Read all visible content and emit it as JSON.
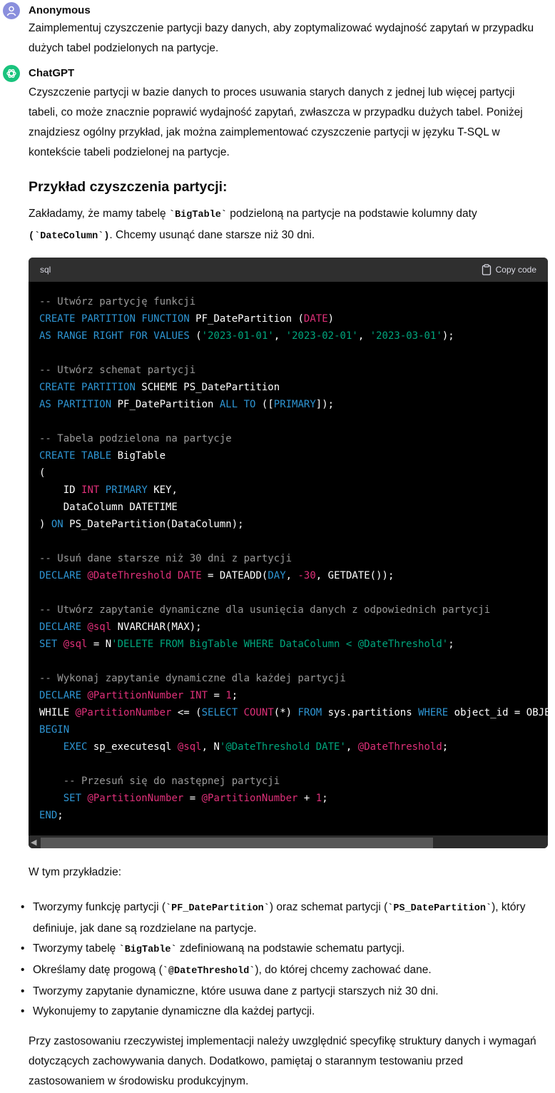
{
  "user": {
    "name": "Anonymous",
    "message": "Zaimplementuj czyszczenie partycji bazy danych, aby zoptymalizować wydajność zapytań w przypadku dużych tabel podzielonych na partycje."
  },
  "assistant": {
    "name": "ChatGPT",
    "intro": "Czyszczenie partycji w bazie danych to proces usuwania starych danych z jednej lub więcej partycji tabeli, co może znacznie poprawić wydajność zapytań, zwłaszcza w przypadku dużych tabel. Poniżej znajdziesz ogólny przykład, jak można zaimplementować czyszczenie partycji w języku T-SQL w kontekście tabeli podzielonej na partycje.",
    "heading": "Przykład czyszczenia partycji:",
    "assume": {
      "p1": "Zakładamy, że mamy tabelę ",
      "code1": "`BigTable`",
      "p2": " podzieloną na partycje na podstawie kolumny daty",
      "code2": "(`DateColumn`)",
      "p3": ". Chcemy usunąć dane starsze niż 30 dni."
    },
    "code_block": {
      "language": "sql",
      "copy_label": "Copy code"
    },
    "in_example": "W tym przykładzie:",
    "bullets": {
      "b1_a": "Tworzymy funkcję partycji (",
      "b1_code1": "`PF_DatePartition`",
      "b1_b": ") oraz schemat partycji (",
      "b1_code2": "`PS_DatePartition`",
      "b1_c": "), który definiuje, jak dane są rozdzielane na partycje.",
      "b2_a": "Tworzymy tabelę ",
      "b2_code": "`BigTable`",
      "b2_b": " zdefiniowaną na podstawie schematu partycji.",
      "b3_a": "Określamy datę progową (",
      "b3_code": "`@DateThreshold`",
      "b3_b": "), do której chcemy zachować dane.",
      "b4": "Tworzymy zapytanie dynamiczne, które usuwa dane z partycji starszych niż 30 dni.",
      "b5": "Wykonujemy to zapytanie dynamiczne dla każdej partycji."
    },
    "closing": "Przy zastosowaniu rzeczywistej implementacji należy uwzględnić specyfikę struktury danych i wymagań dotyczących zachowywania danych. Dodatkowo, pamiętaj o starannym testowaniu przed zastosowaniem w środowisku produkcyjnym."
  },
  "code_lines": [
    [
      [
        "c",
        "-- Utwórz partycję funkcji"
      ]
    ],
    [
      [
        "k",
        "CREATE"
      ],
      [
        "p",
        " "
      ],
      [
        "k",
        "PARTITION"
      ],
      [
        "p",
        " "
      ],
      [
        "k",
        "FUNCTION"
      ],
      [
        "p",
        " PF_DatePartition ("
      ],
      [
        "t",
        "DATE"
      ],
      [
        "p",
        ")"
      ]
    ],
    [
      [
        "k",
        "AS"
      ],
      [
        "p",
        " "
      ],
      [
        "k",
        "RANGE"
      ],
      [
        "p",
        " "
      ],
      [
        "k",
        "RIGHT"
      ],
      [
        "p",
        " "
      ],
      [
        "k",
        "FOR"
      ],
      [
        "p",
        " "
      ],
      [
        "k",
        "VALUES"
      ],
      [
        "p",
        " ("
      ],
      [
        "s",
        "'2023-01-01'"
      ],
      [
        "p",
        ", "
      ],
      [
        "s",
        "'2023-02-01'"
      ],
      [
        "p",
        ", "
      ],
      [
        "s",
        "'2023-03-01'"
      ],
      [
        "p",
        ");"
      ]
    ],
    [],
    [
      [
        "c",
        "-- Utwórz schemat partycji"
      ]
    ],
    [
      [
        "k",
        "CREATE"
      ],
      [
        "p",
        " "
      ],
      [
        "k",
        "PARTITION"
      ],
      [
        "p",
        " SCHEME PS_DatePartition"
      ]
    ],
    [
      [
        "k",
        "AS"
      ],
      [
        "p",
        " "
      ],
      [
        "k",
        "PARTITION"
      ],
      [
        "p",
        " PF_DatePartition "
      ],
      [
        "k",
        "ALL"
      ],
      [
        "p",
        " "
      ],
      [
        "k",
        "TO"
      ],
      [
        "p",
        " (["
      ],
      [
        "k",
        "PRIMARY"
      ],
      [
        "p",
        "]);"
      ]
    ],
    [],
    [
      [
        "c",
        "-- Tabela podzielona na partycje"
      ]
    ],
    [
      [
        "k",
        "CREATE"
      ],
      [
        "p",
        " "
      ],
      [
        "k",
        "TABLE"
      ],
      [
        "p",
        " BigTable"
      ]
    ],
    [
      [
        "p",
        "("
      ]
    ],
    [
      [
        "p",
        "    ID "
      ],
      [
        "t",
        "INT"
      ],
      [
        "p",
        " "
      ],
      [
        "k",
        "PRIMARY"
      ],
      [
        "p",
        " KEY,"
      ]
    ],
    [
      [
        "p",
        "    DataColumn DATETIME"
      ]
    ],
    [
      [
        "p",
        ") "
      ],
      [
        "k",
        "ON"
      ],
      [
        "p",
        " PS_DatePartition(DataColumn);"
      ]
    ],
    [],
    [
      [
        "c",
        "-- Usuń dane starsze niż 30 dni z partycji"
      ]
    ],
    [
      [
        "k",
        "DECLARE"
      ],
      [
        "p",
        " "
      ],
      [
        "t",
        "@DateThreshold"
      ],
      [
        "p",
        " "
      ],
      [
        "t",
        "DATE"
      ],
      [
        "p",
        " = DATEADD("
      ],
      [
        "k",
        "DAY"
      ],
      [
        "p",
        ", "
      ],
      [
        "n",
        "-30"
      ],
      [
        "p",
        ", GETDATE());"
      ]
    ],
    [],
    [
      [
        "c",
        "-- Utwórz zapytanie dynamiczne dla usunięcia danych z odpowiednich partycji"
      ]
    ],
    [
      [
        "k",
        "DECLARE"
      ],
      [
        "p",
        " "
      ],
      [
        "t",
        "@sql"
      ],
      [
        "p",
        " NVARCHAR(MAX);"
      ]
    ],
    [
      [
        "k",
        "SET"
      ],
      [
        "p",
        " "
      ],
      [
        "t",
        "@sql"
      ],
      [
        "p",
        " = N"
      ],
      [
        "s",
        "'DELETE FROM BigTable WHERE DataColumn < @DateThreshold'"
      ],
      [
        "p",
        ";"
      ]
    ],
    [],
    [
      [
        "c",
        "-- Wykonaj zapytanie dynamiczne dla każdej partycji"
      ]
    ],
    [
      [
        "k",
        "DECLARE"
      ],
      [
        "p",
        " "
      ],
      [
        "t",
        "@PartitionNumber"
      ],
      [
        "p",
        " "
      ],
      [
        "t",
        "INT"
      ],
      [
        "p",
        " = "
      ],
      [
        "n",
        "1"
      ],
      [
        "p",
        ";"
      ]
    ],
    [
      [
        "p",
        "WHILE "
      ],
      [
        "t",
        "@PartitionNumber"
      ],
      [
        "p",
        " <= ("
      ],
      [
        "k",
        "SELECT"
      ],
      [
        "p",
        " "
      ],
      [
        "t",
        "COUNT"
      ],
      [
        "p",
        "(*) "
      ],
      [
        "k",
        "FROM"
      ],
      [
        "p",
        " sys.partitions "
      ],
      [
        "k",
        "WHERE"
      ],
      [
        "p",
        " object_id = OBJE"
      ]
    ],
    [
      [
        "k",
        "BEGIN"
      ]
    ],
    [
      [
        "p",
        "    "
      ],
      [
        "k",
        "EXEC"
      ],
      [
        "p",
        " sp_executesql "
      ],
      [
        "t",
        "@sql"
      ],
      [
        "p",
        ", N"
      ],
      [
        "s",
        "'@DateThreshold DATE'"
      ],
      [
        "p",
        ", "
      ],
      [
        "t",
        "@DateThreshold"
      ],
      [
        "p",
        ";"
      ]
    ],
    [],
    [
      [
        "p",
        "    "
      ],
      [
        "c",
        "-- Przesuń się do następnej partycji"
      ]
    ],
    [
      [
        "p",
        "    "
      ],
      [
        "k",
        "SET"
      ],
      [
        "p",
        " "
      ],
      [
        "t",
        "@PartitionNumber"
      ],
      [
        "p",
        " = "
      ],
      [
        "t",
        "@PartitionNumber"
      ],
      [
        "p",
        " + "
      ],
      [
        "n",
        "1"
      ],
      [
        "p",
        ";"
      ]
    ],
    [
      [
        "k",
        "END"
      ],
      [
        "p",
        ";"
      ]
    ]
  ]
}
